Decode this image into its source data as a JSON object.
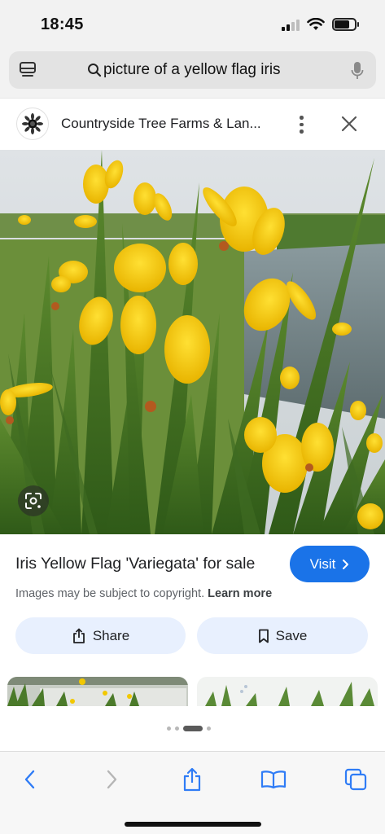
{
  "status_bar": {
    "time": "18:45",
    "battery_level": 0.75
  },
  "url_bar": {
    "query": "picture of a yellow flag iris",
    "search_icon": "search-icon",
    "tabs_icon": "tab-overview-icon",
    "mic_icon": "microphone-icon"
  },
  "source": {
    "name": "Countryside Tree Farms & Lan...",
    "favicon": "sunflower-logo",
    "menu_icon": "more-vert-icon",
    "close_icon": "close-icon"
  },
  "image": {
    "alt_subject": "yellow flag iris photo",
    "lens_icon": "google-lens-icon"
  },
  "result": {
    "title": "Iris Yellow Flag 'Variegata' for sale",
    "visit_label": "Visit",
    "copyright_text": "Images may be subject to copyright.",
    "learn_more": "Learn more",
    "share_label": "Share",
    "save_label": "Save"
  },
  "pager": {
    "count": 4,
    "active_index": 2
  },
  "toolbar": {
    "items": [
      "back-icon",
      "forward-icon",
      "share-icon",
      "bookmarks-icon",
      "tabs-icon"
    ]
  },
  "colors": {
    "accent": "#1a73e8",
    "tonal_button": "#e8f0fe",
    "safari_blue": "#2f7cf6"
  }
}
